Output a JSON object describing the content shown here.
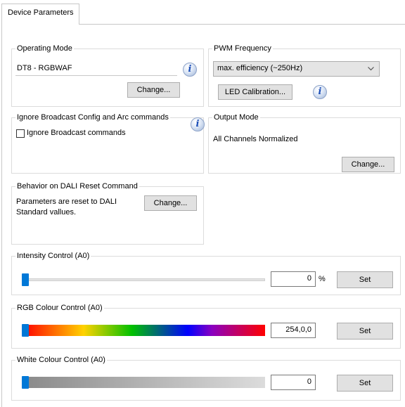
{
  "tab": {
    "label": "Device Parameters"
  },
  "operating_mode": {
    "legend": "Operating Mode",
    "value": "DT8 - RGBWAF",
    "change_label": "Change..."
  },
  "pwm": {
    "legend": "PWM Frequency",
    "selected": "max. efficiency (~250Hz)",
    "calibration_label": "LED Calibration..."
  },
  "ignore_broadcast": {
    "legend": "Ignore Broadcast Config and Arc commands",
    "checkbox_label": "Ignore Broadcast commands",
    "checked": false
  },
  "output_mode": {
    "legend": "Output Mode",
    "value": "All Channels Normalized",
    "change_label": "Change..."
  },
  "reset_behavior": {
    "legend": "Behavior on DALI Reset Command",
    "text_line1": "Parameters are reset to DALI",
    "text_line2": "Standard vallues.",
    "change_label": "Change..."
  },
  "intensity": {
    "legend": "Intensity Control (A0)",
    "value": "0",
    "unit": "%",
    "set_label": "Set",
    "level": 0
  },
  "rgb": {
    "legend": "RGB Colour Control (A0)",
    "value": "254,0,0",
    "set_label": "Set",
    "level": 0
  },
  "white": {
    "legend": "White Colour Control (A0)",
    "value": "0",
    "set_label": "Set",
    "level": 0
  },
  "colors": {
    "accent": "#0078d7",
    "info_icon": "#1d4fb8"
  },
  "icons": [
    "info-icon",
    "chevron-down-icon"
  ]
}
